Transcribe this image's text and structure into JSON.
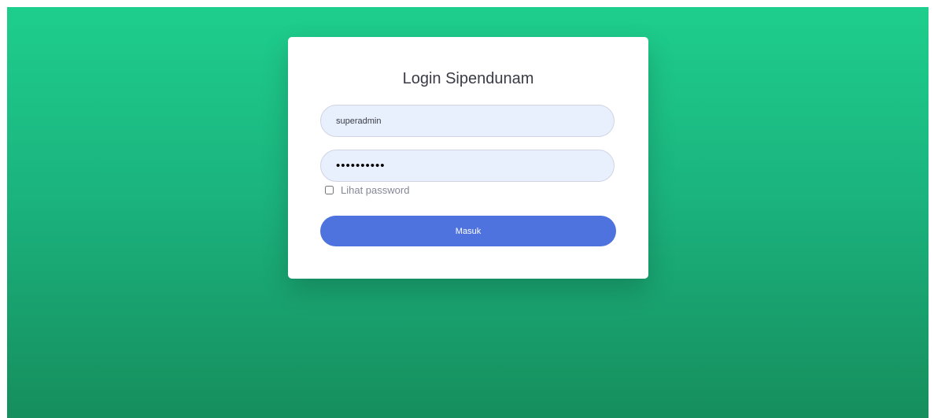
{
  "colors": {
    "background_gradient": [
      "#1ece8c",
      "#1bb47f",
      "#168e5d"
    ],
    "card": "#ffffff",
    "input_fill": "#e8f0fe",
    "button": "#4e73df",
    "title_text": "#3a3b45",
    "muted_text": "#858796"
  },
  "login": {
    "title": "Login Sipendunam",
    "username_value": "superadmin",
    "password_value": "••••••••••",
    "show_password_label": "Lihat password",
    "show_password_checked": false,
    "submit_label": "Masuk"
  }
}
